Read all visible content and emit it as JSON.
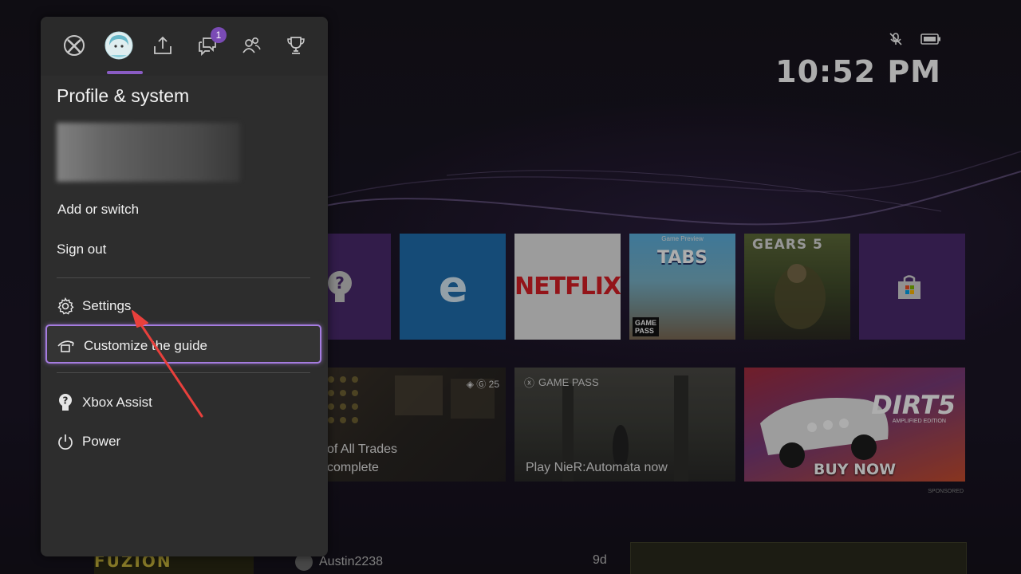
{
  "status": {
    "icons": [
      "mic-muted-icon",
      "battery-icon"
    ],
    "time": "10:52 PM"
  },
  "home": {
    "tiles": {
      "help_icon": "question-bulb-icon",
      "edge_icon": "edge-icon",
      "netflix": "NETFLIX",
      "tabs_caption": "Game Preview",
      "tabs_title": "TABS",
      "tabs_badge_line1": "GAME",
      "tabs_badge_line2": "PASS",
      "gears_title": "GEARS 5",
      "store_icon": "store-bag-icon"
    },
    "wide_tiles": {
      "achievement_line1": "of All Trades",
      "achievement_line2": "complete",
      "achievement_score": "25",
      "gamepass_label": "GAME PASS",
      "gamepass_text": "Play NieR:Automata now",
      "dirt_logo": "DIRT5",
      "dirt_sub": "AMPLIFIED EDITION",
      "buy_now": "BUY NOW",
      "sponsored": "SPONSORED"
    },
    "bottom": {
      "left_text": "FUZION",
      "user": "Austin2238",
      "age": "9d"
    }
  },
  "guide": {
    "tabs": [
      {
        "name": "xbox-icon"
      },
      {
        "name": "avatar"
      },
      {
        "name": "share-icon"
      },
      {
        "name": "chat-icon",
        "badge": "1"
      },
      {
        "name": "people-icon"
      },
      {
        "name": "trophy-icon"
      }
    ],
    "title": "Profile & system",
    "items": {
      "add_switch": "Add or switch",
      "sign_out": "Sign out",
      "settings": "Settings",
      "customize": "Customize the guide",
      "assist": "Xbox Assist",
      "power": "Power"
    }
  },
  "colors": {
    "accent": "#8a5cc4",
    "focus": "#a57ce0",
    "panel": "#2d2d2d",
    "annotation_arrow": "#e8403c"
  }
}
